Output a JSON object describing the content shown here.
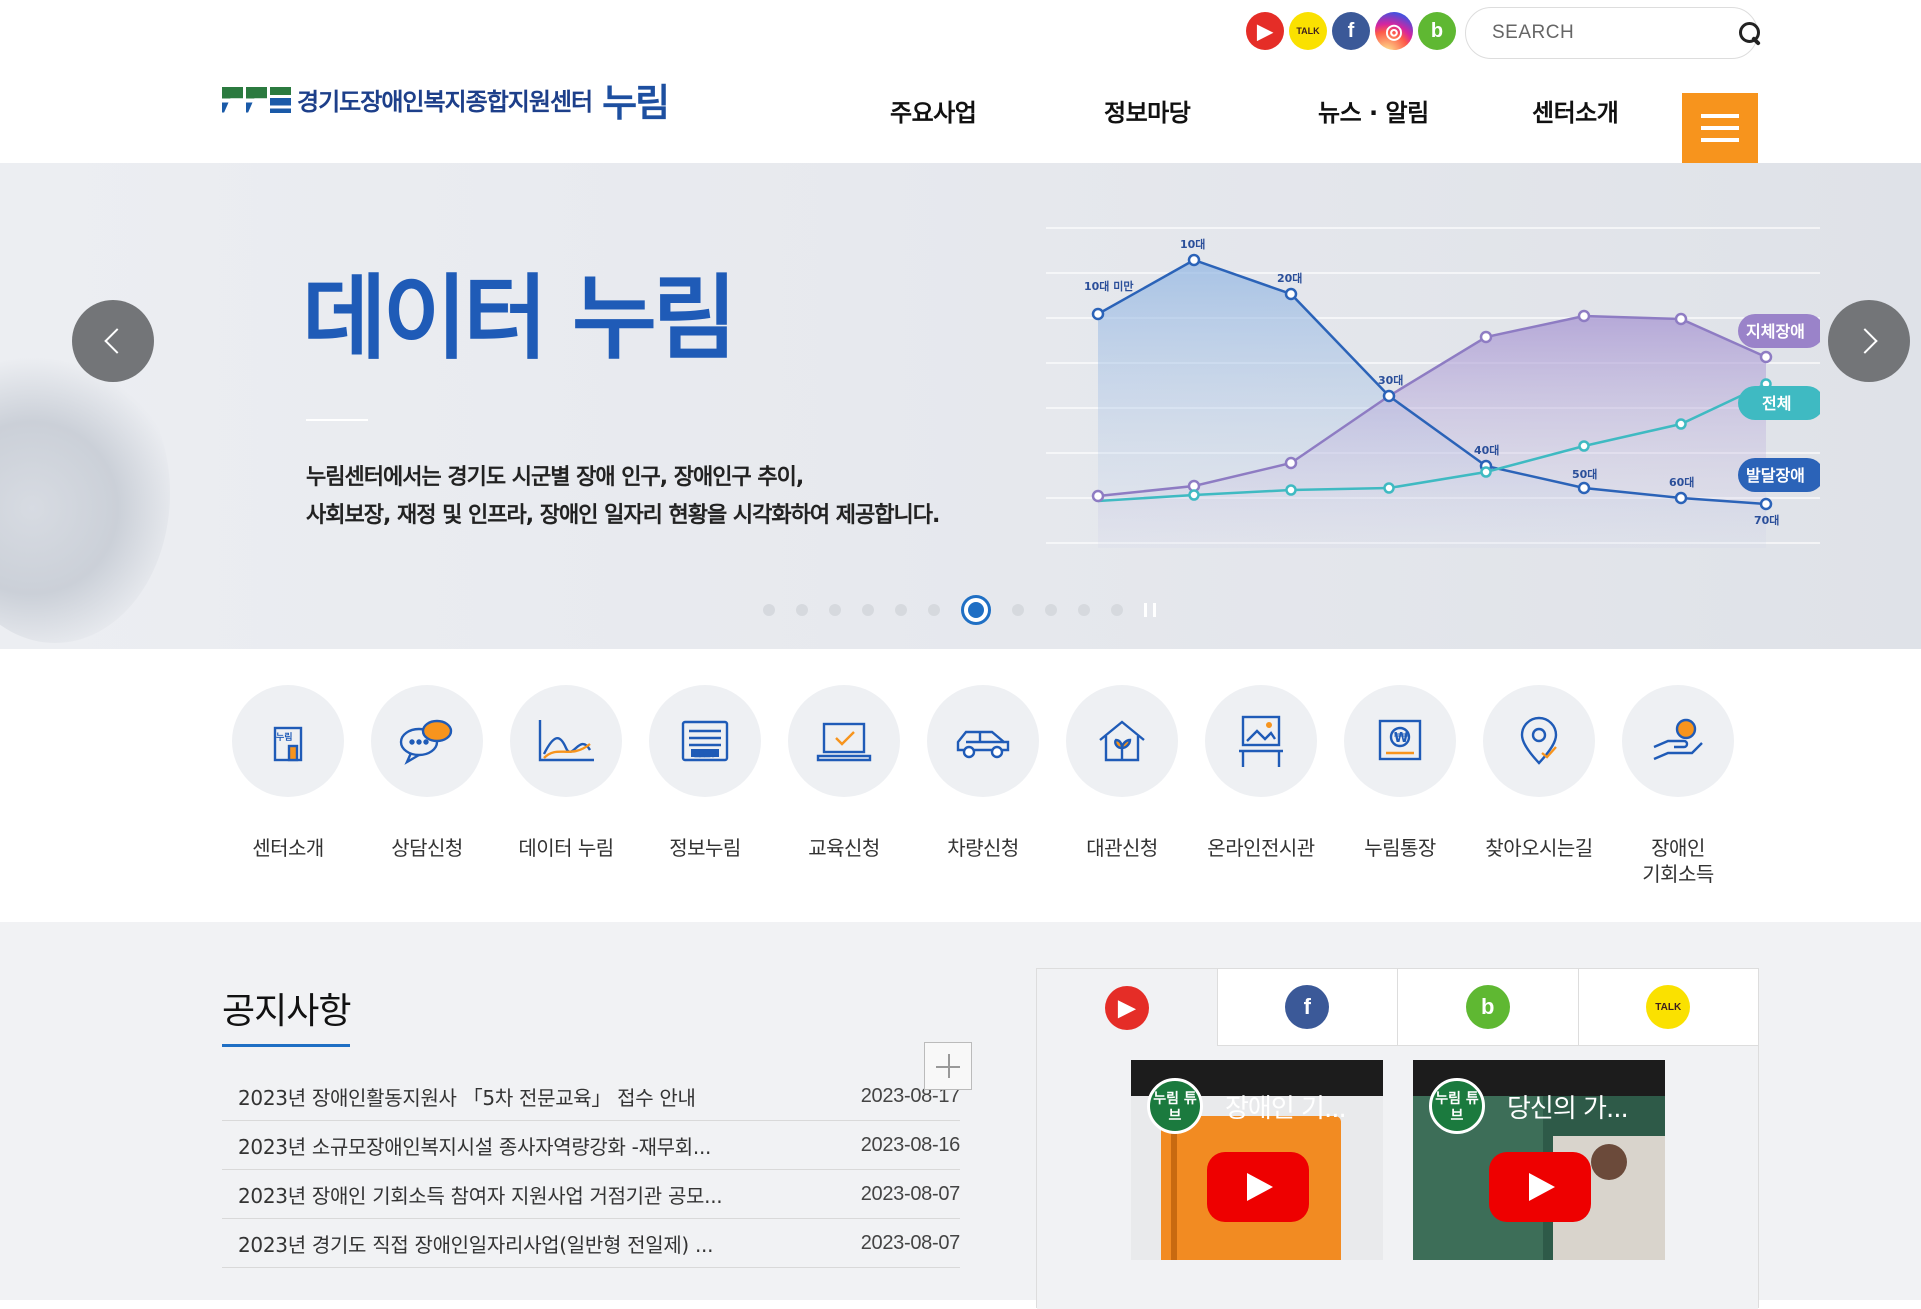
{
  "header": {
    "site_name": "경기도장애인복지종합지원센터",
    "logo_brand": "누림",
    "search_placeholder": "SEARCH",
    "social": [
      {
        "name": "youtube",
        "glyph": "▶"
      },
      {
        "name": "kakao-talk",
        "glyph": "TALK"
      },
      {
        "name": "facebook",
        "glyph": "f"
      },
      {
        "name": "instagram",
        "glyph": "◎"
      },
      {
        "name": "blog",
        "glyph": "b"
      }
    ],
    "nav": [
      "주요사업",
      "정보마당",
      "뉴스 · 알림",
      "센터소개"
    ]
  },
  "hero": {
    "title": "데이터 누림",
    "desc_line1": "누림센터에서는 경기도 시군별 장애 인구, 장애인구 추이,",
    "desc_line2": "사회보장, 재정 및 인프라, 장애인 일자리 현황을 시각화하여 제공합니다.",
    "chart_labels": {
      "age": [
        "10대 미만",
        "10대",
        "20대",
        "30대",
        "40대",
        "50대",
        "60대",
        "70대"
      ],
      "series": [
        "지체장애",
        "전체",
        "발달장애"
      ]
    },
    "colors": {
      "title": "#1f5bb7",
      "purple": "#8e7cc3",
      "blue": "#2b63b8",
      "teal": "#3fbac2"
    }
  },
  "quick_menu": [
    {
      "label": "센터소개",
      "icon": "nurim-building-icon"
    },
    {
      "label": "상담신청",
      "icon": "chat-bubbles-icon"
    },
    {
      "label": "데이터 누림",
      "icon": "data-chart-icon"
    },
    {
      "label": "정보누림",
      "icon": "news-icon"
    },
    {
      "label": "교육신청",
      "icon": "laptop-check-icon"
    },
    {
      "label": "차량신청",
      "icon": "car-icon"
    },
    {
      "label": "대관신청",
      "icon": "house-sprout-icon"
    },
    {
      "label": "온라인전시관",
      "icon": "gallery-frame-icon"
    },
    {
      "label": "누림통장",
      "icon": "bankbook-won-icon"
    },
    {
      "label": "찾아오시는길",
      "icon": "location-pin-icon"
    },
    {
      "label": "장애인\n기회소득",
      "icon": "hand-coins-icon"
    }
  ],
  "notice": {
    "title": "공지사항",
    "items": [
      {
        "title": "2023년 장애인활동지원사 「5차 전문교육」 접수 안내",
        "date": "2023-08-17"
      },
      {
        "title": "2023년 소규모장애인복지시설 종사자역량강화 -재무회...",
        "date": "2023-08-16"
      },
      {
        "title": "2023년 장애인 기회소득 참여자 지원사업 거점기관 공모...",
        "date": "2023-08-07"
      },
      {
        "title": "2023년 경기도 직접 장애인일자리사업(일반형 전일제) ...",
        "date": "2023-08-07"
      }
    ]
  },
  "sns": {
    "tabs": [
      {
        "name": "youtube",
        "glyph": "▶",
        "color": "#e52d27"
      },
      {
        "name": "facebook",
        "glyph": "f",
        "color": "#3b5998"
      },
      {
        "name": "blog",
        "glyph": "b",
        "color": "#5fb832"
      },
      {
        "name": "kakao-talk",
        "glyph": "TALK",
        "color": "#fae100"
      }
    ],
    "videos": [
      {
        "badge": "누림\n튜브",
        "title": "장애인 기..."
      },
      {
        "badge": "누림\n튜브",
        "title": "당신의 가..."
      }
    ]
  }
}
